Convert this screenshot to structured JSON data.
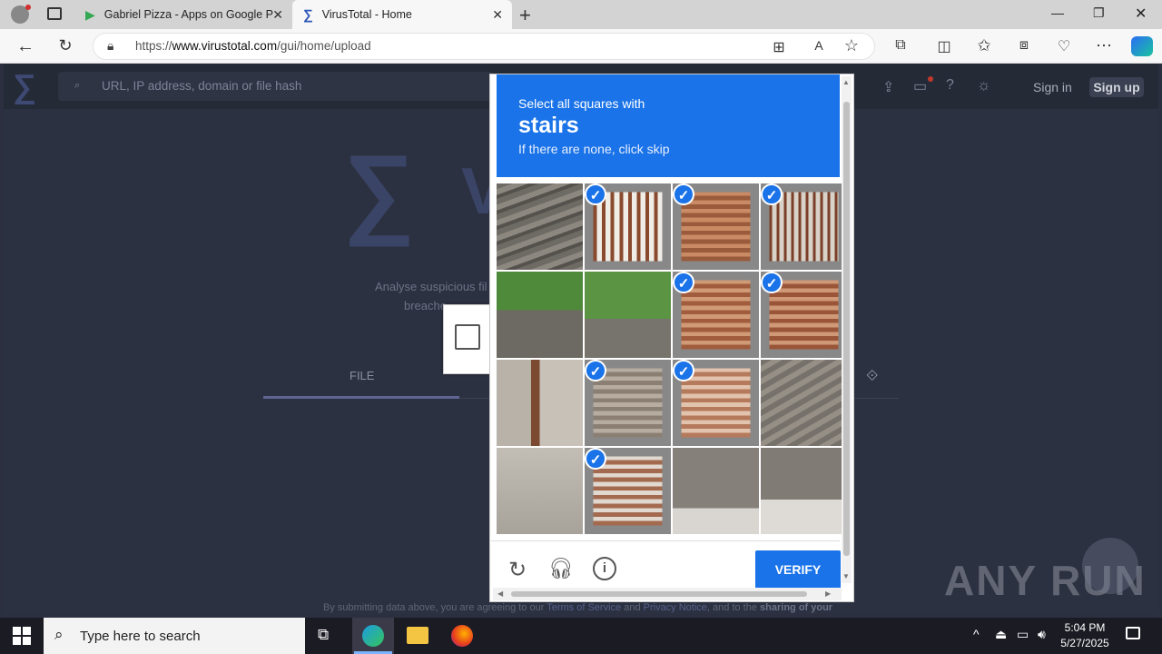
{
  "browser": {
    "tabs": [
      {
        "label": "Gabriel Pizza - Apps on Google P"
      },
      {
        "label": "VirusTotal - Home"
      }
    ],
    "url_prefix": "https://",
    "url_host": "www.virustotal.com",
    "url_path": "/gui/home/upload"
  },
  "virustotal": {
    "search_placeholder": "URL, IP address, domain or file hash",
    "sign_in": "Sign in",
    "sign_up": "Sign up",
    "tab_file": "FILE",
    "analyse_text": "Analyse suspicious fil",
    "breach_text": "breache",
    "footer": {
      "pre": "By submitting data above, you are agreeing to our ",
      "tos": "Terms of Service",
      "and": " and ",
      "privacy": "Privacy Notice",
      "post": ", and to the ",
      "bold": "sharing of your"
    }
  },
  "captcha": {
    "line1": "Select all squares with",
    "keyword": "stairs",
    "line3": "If there are none, click skip",
    "verify": "VERIFY",
    "selected": [
      false,
      true,
      true,
      true,
      false,
      false,
      true,
      true,
      false,
      true,
      true,
      false,
      false,
      true,
      false,
      false
    ]
  },
  "watermark": "ANY RUN",
  "taskbar": {
    "search_placeholder": "Type here to search",
    "time": "5:04 PM",
    "date": "5/27/2025"
  }
}
